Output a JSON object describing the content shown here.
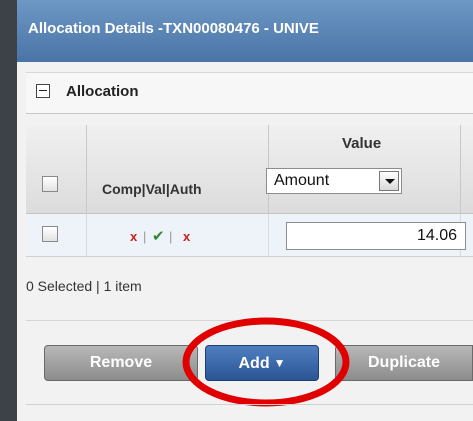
{
  "window": {
    "title": "Allocation Details -TXN00080476 - UNIVE"
  },
  "section": {
    "title": "Allocation"
  },
  "grid": {
    "columns": {
      "status_header": "Comp|Val|Auth",
      "value_header": "Value"
    },
    "value_type_select": {
      "selected": "Amount"
    },
    "rows": [
      {
        "comp": "x",
        "val": "✔",
        "auth": "x",
        "value": "14.06"
      }
    ],
    "separator": "|"
  },
  "footer": {
    "summary": "0 Selected | 1 item"
  },
  "buttons": {
    "remove": "Remove",
    "add": "Add",
    "add_caret": "▼",
    "duplicate": "Duplicate"
  },
  "colors": {
    "titlebar": "#5a85b8",
    "status_fail": "#cc1f1f",
    "status_ok": "#2b8a2b",
    "highlight_circle": "#e00000"
  }
}
